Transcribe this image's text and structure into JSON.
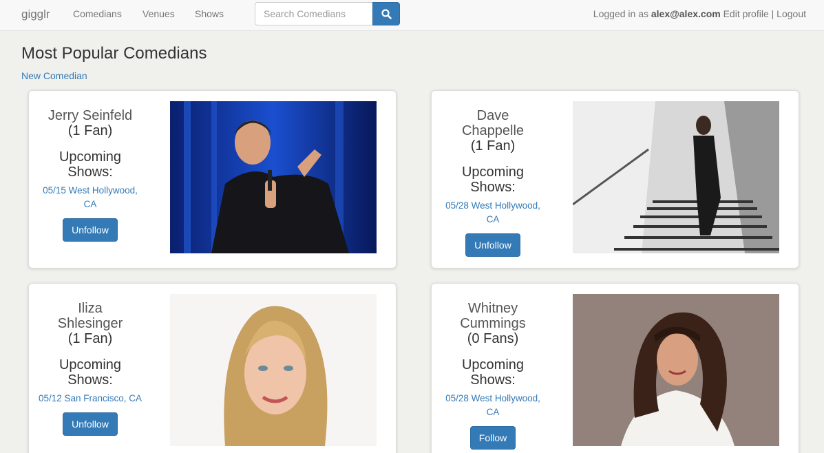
{
  "navbar": {
    "brand": "gigglr",
    "links": [
      "Comedians",
      "Venues",
      "Shows"
    ],
    "search_placeholder": "Search Comedians",
    "logged_in_prefix": "Logged in as",
    "user_email": "alex@alex.com",
    "edit_profile": "Edit profile",
    "separator": "|",
    "logout": "Logout"
  },
  "page": {
    "title": "Most Popular Comedians",
    "new_link": "New Comedian",
    "upcoming_label": "Upcoming Shows:"
  },
  "comedians": [
    {
      "name": "Jerry Seinfeld",
      "fans": "(1 Fan)",
      "show": "05/15 West Hollywood, CA",
      "button": "Unfollow"
    },
    {
      "name": "Dave Chappelle",
      "fans": "(1 Fan)",
      "show": "05/28 West Hollywood, CA",
      "button": "Unfollow"
    },
    {
      "name": "Iliza Shlesinger",
      "fans": "(1 Fan)",
      "show": "05/12 San Francisco, CA",
      "button": "Unfollow"
    },
    {
      "name": "Whitney Cummings",
      "fans": "(0 Fans)",
      "show": "05/28 West Hollywood, CA",
      "button": "Follow"
    }
  ],
  "colors": {
    "link": "#337ab7",
    "button": "#337ab7",
    "background": "#f0f0ed"
  }
}
